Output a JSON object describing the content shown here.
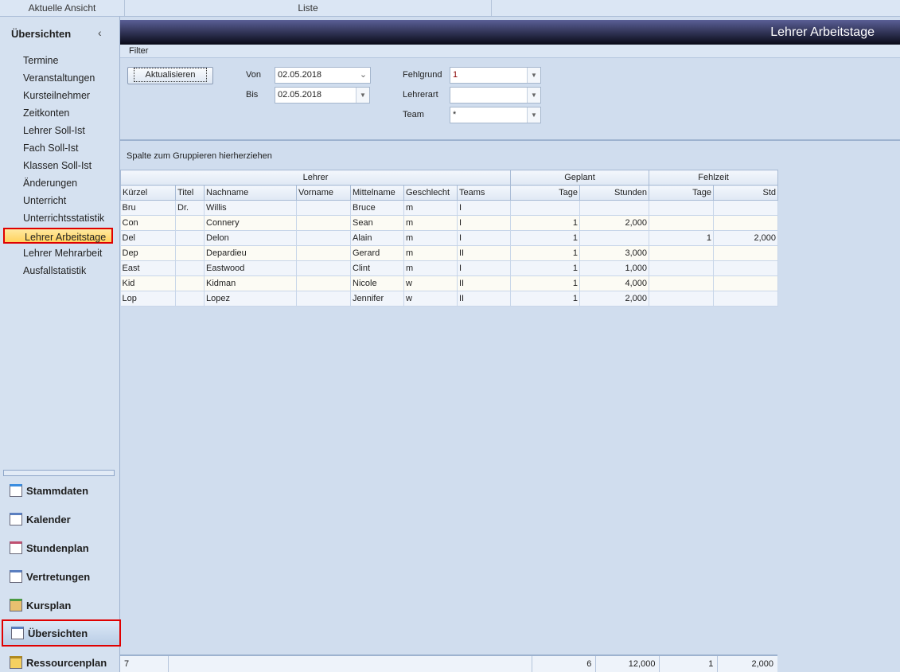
{
  "topbar": {
    "current_view": "Aktuelle Ansicht",
    "list": "Liste"
  },
  "sidebar": {
    "title": "Übersichten",
    "collapse_icon": "‹",
    "items": [
      "Termine",
      "Veranstaltungen",
      "Kursteilnehmer",
      "Zeitkonten",
      "Lehrer Soll-Ist",
      "Fach Soll-Ist",
      "Klassen Soll-Ist",
      "Änderungen",
      "Unterricht",
      "Unterrichtsstatistik",
      "Lehrer Arbeitstage",
      "Lehrer Mehrarbeit",
      "Ausfallstatistik"
    ],
    "selected": "Lehrer Arbeitstage",
    "nav": [
      "Stammdaten",
      "Kalender",
      "Stundenplan",
      "Vertretungen",
      "Kursplan",
      "Übersichten",
      "Ressourcenplan"
    ]
  },
  "header": {
    "title": "Lehrer Arbeitstage"
  },
  "filter": {
    "label": "Filter",
    "refresh": "Aktualisieren",
    "von_label": "Von",
    "von": "02.05.2018",
    "bis_label": "Bis",
    "bis": "02.05.2018",
    "fehlgrund_label": "Fehlgrund",
    "fehlgrund": "1",
    "lehrerart_label": "Lehrerart",
    "lehrerart": "",
    "team_label": "Team",
    "team": "*"
  },
  "group_hint": "Spalte zum Gruppieren hierherziehen",
  "grid": {
    "bands": [
      "Lehrer",
      "Geplant",
      "Fehlzeit"
    ],
    "columns": [
      "Kürzel",
      "Titel",
      "Nachname",
      "Vorname",
      "Mittelname",
      "Geschlecht",
      "Teams",
      "Tage",
      "Stunden",
      "Tage",
      "Std"
    ],
    "rows": [
      [
        "Bru",
        "Dr.",
        "Willis",
        "",
        "Bruce",
        "m",
        "I",
        "",
        "",
        "",
        ""
      ],
      [
        "Con",
        "",
        "Connery",
        "",
        "Sean",
        "m",
        "I",
        "1",
        "2,000",
        "",
        ""
      ],
      [
        "Del",
        "",
        "Delon",
        "",
        "Alain",
        "m",
        "I",
        "1",
        "",
        "1",
        "2,000"
      ],
      [
        "Dep",
        "",
        "Depardieu",
        "",
        "Gerard",
        "m",
        "II",
        "1",
        "3,000",
        "",
        ""
      ],
      [
        "East",
        "",
        "Eastwood",
        "",
        "Clint",
        "m",
        "I",
        "1",
        "1,000",
        "",
        ""
      ],
      [
        "Kid",
        "",
        "Kidman",
        "",
        "Nicole",
        "w",
        "II",
        "1",
        "4,000",
        "",
        ""
      ],
      [
        "Lop",
        "",
        "Lopez",
        "",
        "Jennifer",
        "w",
        "II",
        "1",
        "2,000",
        "",
        ""
      ]
    ]
  },
  "footer": {
    "count": "7",
    "tage": "6",
    "stunden": "12,000",
    "fehl_tage": "1",
    "fehl_std": "2,000"
  }
}
